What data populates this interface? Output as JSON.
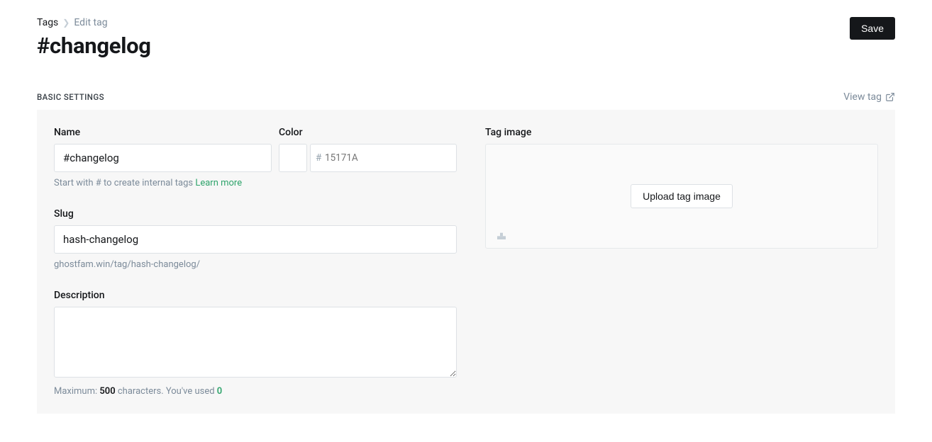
{
  "breadcrumb": {
    "root": "Tags",
    "current": "Edit tag"
  },
  "page_title": "#changelog",
  "save_label": "Save",
  "section_label": "BASIC SETTINGS",
  "view_tag_label": "View tag",
  "fields": {
    "name": {
      "label": "Name",
      "value": "#changelog",
      "hint_prefix": "Start with # to create internal tags ",
      "learn_more": "Learn more"
    },
    "color": {
      "label": "Color",
      "placeholder": "15171A",
      "value": ""
    },
    "slug": {
      "label": "Slug",
      "value": "hash-changelog",
      "preview": "ghostfam.win/tag/hash-changelog/"
    },
    "description": {
      "label": "Description",
      "value": "",
      "max_prefix": "Maximum: ",
      "max_value": "500",
      "max_suffix": " characters. You've used ",
      "used": "0"
    },
    "image": {
      "label": "Tag image",
      "button": "Upload tag image"
    }
  }
}
